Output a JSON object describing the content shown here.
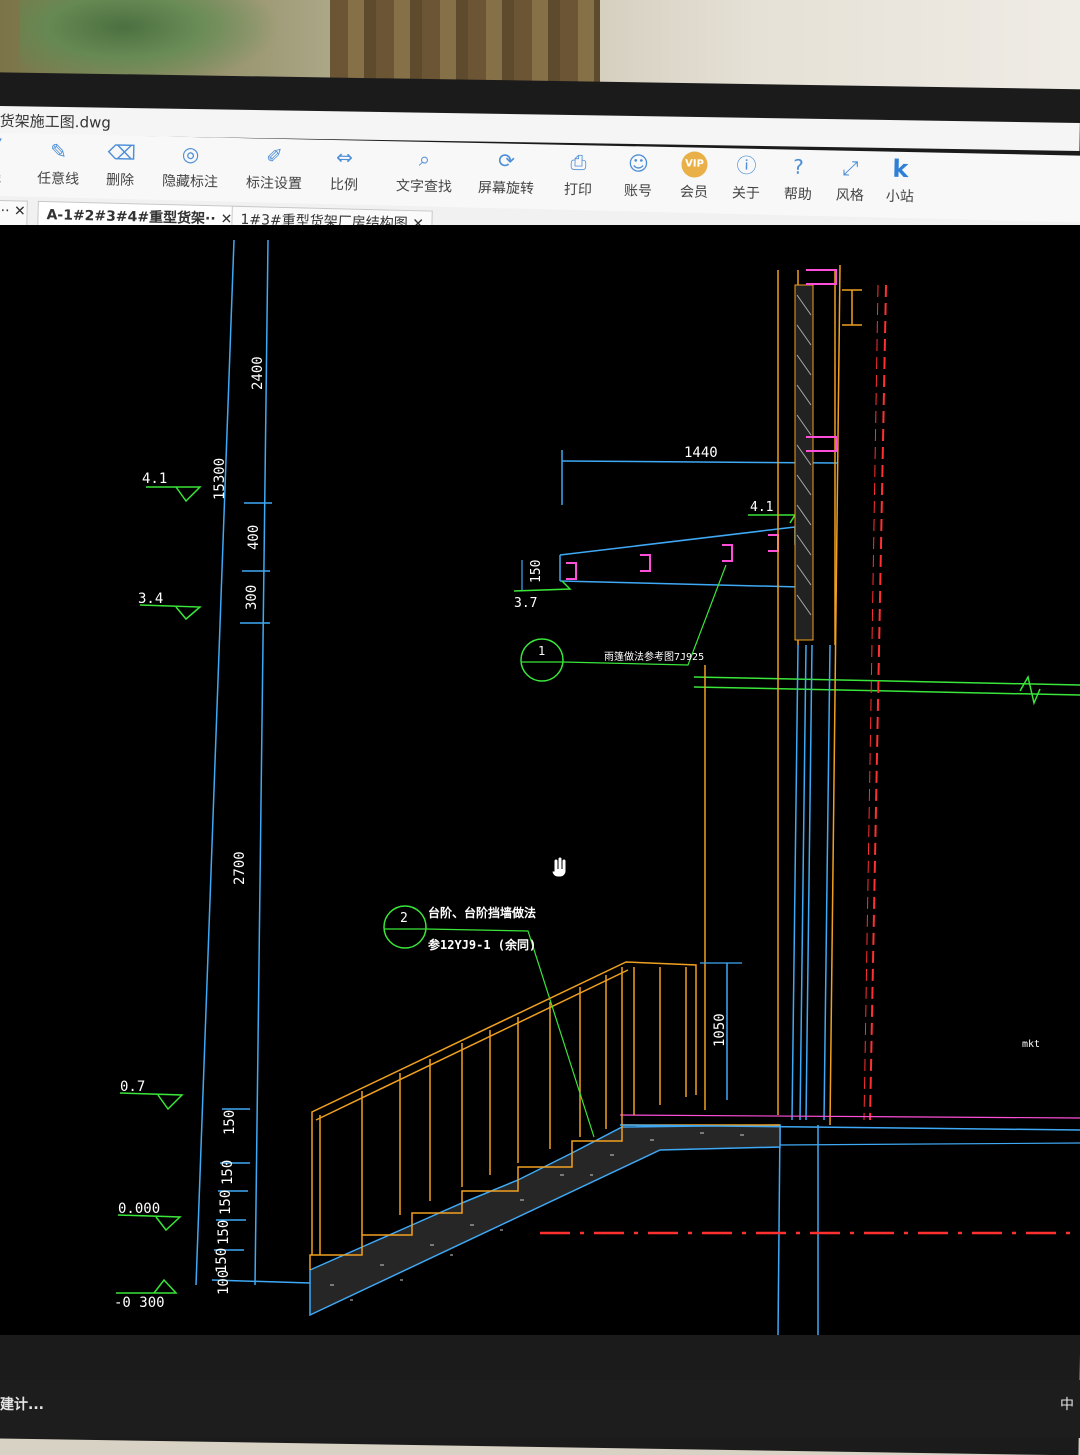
{
  "window": {
    "title": "货架施工图.dwg"
  },
  "toolbar": [
    {
      "label": "线",
      "icon": "line-icon"
    },
    {
      "label": "任意线",
      "icon": "pen-icon"
    },
    {
      "label": "删除",
      "icon": "eraser-icon"
    },
    {
      "label": "隐藏标注",
      "icon": "eye-off-icon"
    },
    {
      "label": "标注设置",
      "icon": "dimension-settings-icon"
    },
    {
      "label": "比例",
      "icon": "scale-icon"
    },
    {
      "label": "文字查找",
      "icon": "text-search-icon"
    },
    {
      "label": "屏幕旋转",
      "icon": "screen-rotate-icon"
    },
    {
      "label": "打印",
      "icon": "printer-icon"
    },
    {
      "label": "账号",
      "icon": "user-icon"
    },
    {
      "label": "会员",
      "icon": "vip-icon",
      "badge": "VIP"
    },
    {
      "label": "关于",
      "icon": "info-icon"
    },
    {
      "label": "帮助",
      "icon": "help-icon"
    },
    {
      "label": "风格",
      "icon": "style-icon"
    },
    {
      "label": "小站",
      "icon": "k-icon",
      "glyph": "k"
    }
  ],
  "tabs": [
    {
      "label": "A-1#2#3#4#重型货架··",
      "active": true
    },
    {
      "label": "1#3#重型货架厂房结构图",
      "active": false
    }
  ],
  "drawing": {
    "dims_left": [
      "2400",
      "15300",
      "400",
      "300",
      "2700",
      "150",
      "150",
      "150",
      "150",
      "150",
      "100"
    ],
    "levels": [
      "4.1",
      "3.4",
      "0.7",
      "0.000",
      "-0 300"
    ],
    "canopy": {
      "width": "1440",
      "level_top": "4.1",
      "level_bottom": "3.7",
      "thickness": "150"
    },
    "callout1": {
      "num": "1",
      "text": "雨篷做法参考图7J925"
    },
    "callout2": {
      "num": "2",
      "line1": "台阶、台阶挡墙做法",
      "line2": "参12YJ9-1 (余同)"
    },
    "rail_height": "1050",
    "right_label": "mkt"
  },
  "status": {
    "text": "建计...",
    "tray": "中"
  },
  "colors": {
    "dim": "#3fa9f5",
    "green": "#39e639",
    "orange": "#f0a020",
    "magenta": "#ff4fd8",
    "red": "#ff3030",
    "white": "#ffffff"
  }
}
